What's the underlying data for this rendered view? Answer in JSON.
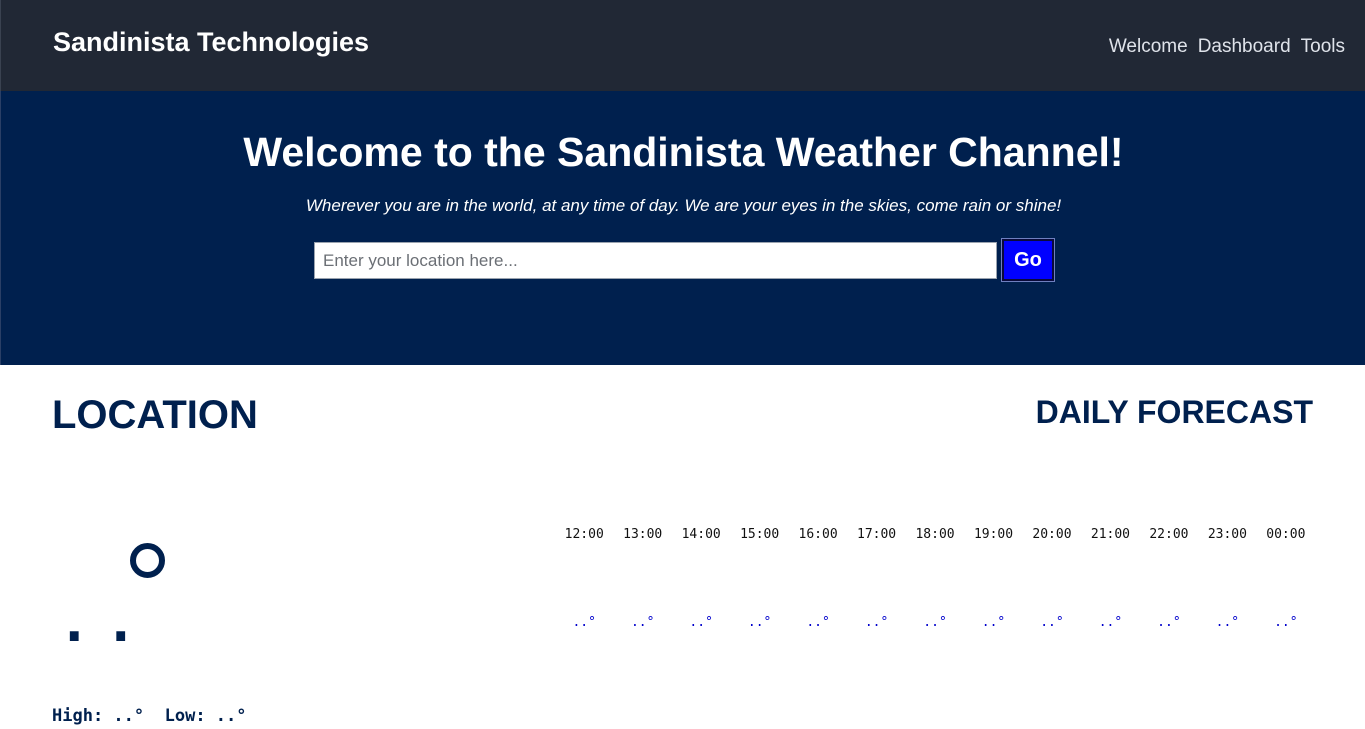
{
  "navbar": {
    "brand": "Sandinista Technologies",
    "links": [
      {
        "label": "Welcome"
      },
      {
        "label": "Dashboard"
      },
      {
        "label": "Tools"
      }
    ]
  },
  "hero": {
    "title": "Welcome to the Sandinista Weather Channel!",
    "subtitle": "Wherever you are in the world, at any time of day. We are your eyes in the skies, come rain or shine!",
    "search": {
      "placeholder": "Enter your location here...",
      "value": "",
      "button_label": "Go"
    }
  },
  "location": {
    "title": "LOCATION",
    "current_temp": "..",
    "icon": "circle-weather-icon",
    "high_label": "High: ..°",
    "low_label": "Low: ..°"
  },
  "forecast": {
    "title": "DAILY FORECAST",
    "hours": [
      {
        "time": "12:00",
        "temp": "..°"
      },
      {
        "time": "13:00",
        "temp": "..°"
      },
      {
        "time": "14:00",
        "temp": "..°"
      },
      {
        "time": "15:00",
        "temp": "..°"
      },
      {
        "time": "16:00",
        "temp": "..°"
      },
      {
        "time": "17:00",
        "temp": "..°"
      },
      {
        "time": "18:00",
        "temp": "..°"
      },
      {
        "time": "19:00",
        "temp": "..°"
      },
      {
        "time": "20:00",
        "temp": "..°"
      },
      {
        "time": "21:00",
        "temp": "..°"
      },
      {
        "time": "22:00",
        "temp": "..°"
      },
      {
        "time": "23:00",
        "temp": "..°"
      },
      {
        "time": "00:00",
        "temp": "..°"
      }
    ]
  },
  "colors": {
    "navbar_bg": "#212835",
    "hero_bg": "#00204e",
    "accent_button": "#0000ff",
    "heading": "#00204e"
  }
}
